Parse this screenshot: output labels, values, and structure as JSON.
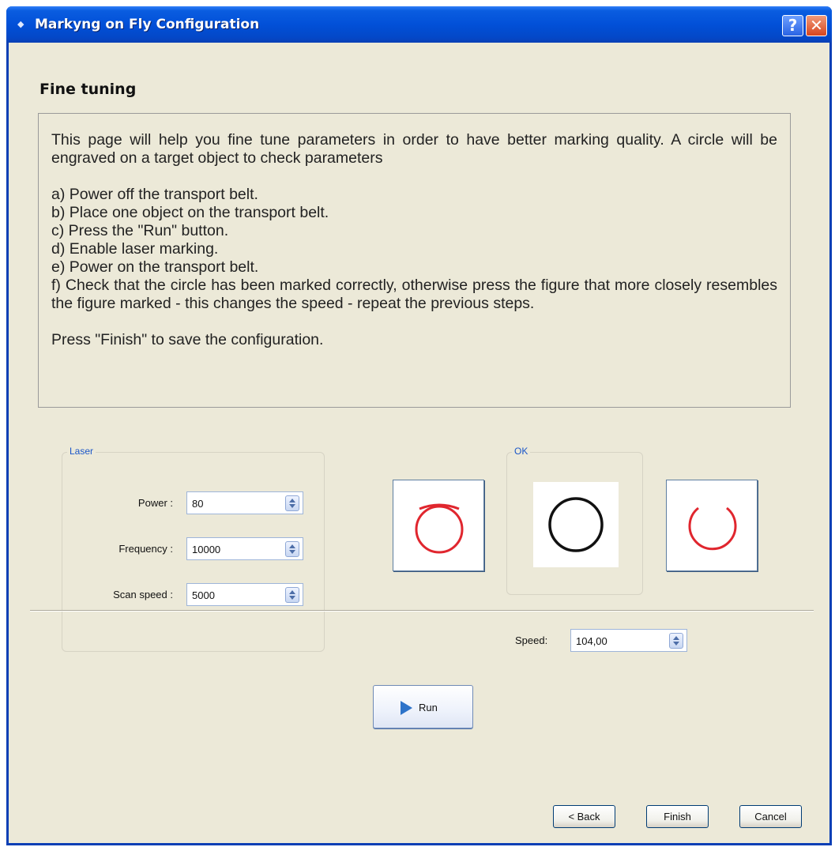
{
  "window": {
    "title": "Markyng on Fly Configuration",
    "help_label": "?",
    "close_label": "✕"
  },
  "page": {
    "title": "Fine tuning"
  },
  "instructions": {
    "intro": "This page will help you fine tune parameters in order to have better marking quality. A circle will be engraved on a target object to check parameters",
    "steps": [
      "a) Power off the transport belt.",
      "b) Place one object on the transport belt.",
      "c) Press the \"Run\" button.",
      "d) Enable laser marking.",
      "e) Power on the transport belt.",
      "f) Check that the circle has been marked correctly, otherwise press the figure that more closely resembles the figure marked - this changes the speed - repeat the previous steps."
    ],
    "footer": "Press \"Finish\" to save the configuration."
  },
  "laser": {
    "group_label": "Laser",
    "power_label": "Power :",
    "power_value": "80",
    "frequency_label": "Frequency :",
    "frequency_value": "10000",
    "scan_speed_label": "Scan speed :",
    "scan_speed_value": "5000"
  },
  "figures": {
    "ok_group_label": "OK",
    "items": [
      {
        "name": "circle-overlap-figure",
        "color": "#e0262e"
      },
      {
        "name": "circle-ok-figure",
        "color": "#111111"
      },
      {
        "name": "circle-gap-figure",
        "color": "#e0262e"
      }
    ]
  },
  "speed": {
    "label": "Speed:",
    "value": "104,00"
  },
  "run_button": {
    "label": "Run"
  },
  "footer_buttons": {
    "back": "< Back",
    "finish": "Finish",
    "cancel": "Cancel"
  }
}
